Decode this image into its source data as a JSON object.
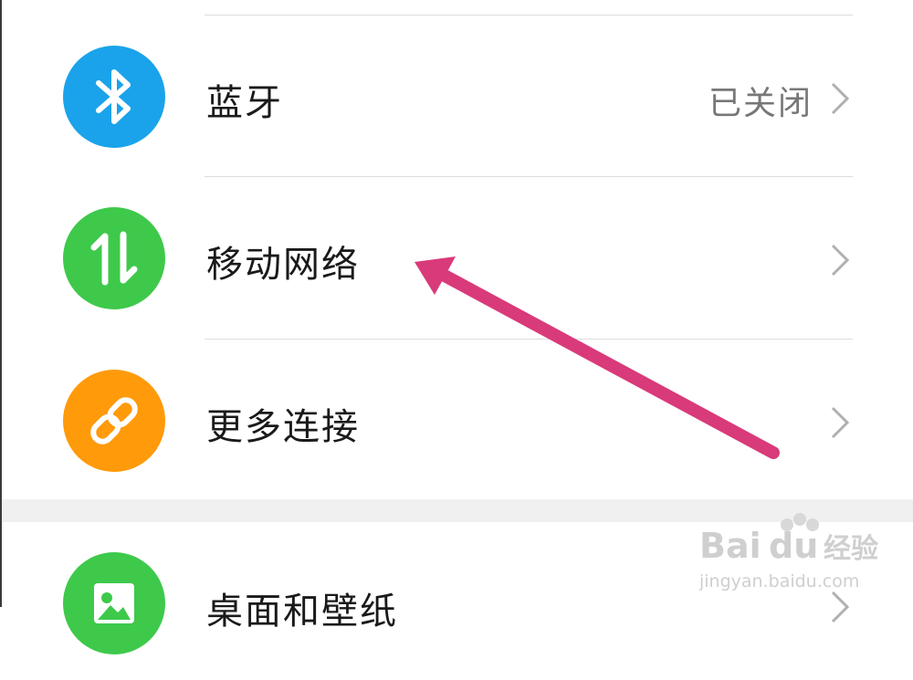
{
  "settings": {
    "items": [
      {
        "label": "蓝牙",
        "value": "已关闭",
        "icon": "bluetooth-icon",
        "color": "#1aa3ea"
      },
      {
        "label": "移动网络",
        "value": "",
        "icon": "mobile-data-icon",
        "color": "#3ec94b"
      },
      {
        "label": "更多连接",
        "value": "",
        "icon": "link-icon",
        "color": "#ff9a0a"
      },
      {
        "label": "桌面和壁纸",
        "value": "",
        "icon": "wallpaper-icon",
        "color": "#3ec94b"
      }
    ]
  },
  "annotation": {
    "arrow_color": "#d93a7a"
  },
  "watermark": {
    "brand": "Bai",
    "brand2": "du",
    "brand_cn": "经验",
    "url": "jingyan.baidu.com"
  }
}
